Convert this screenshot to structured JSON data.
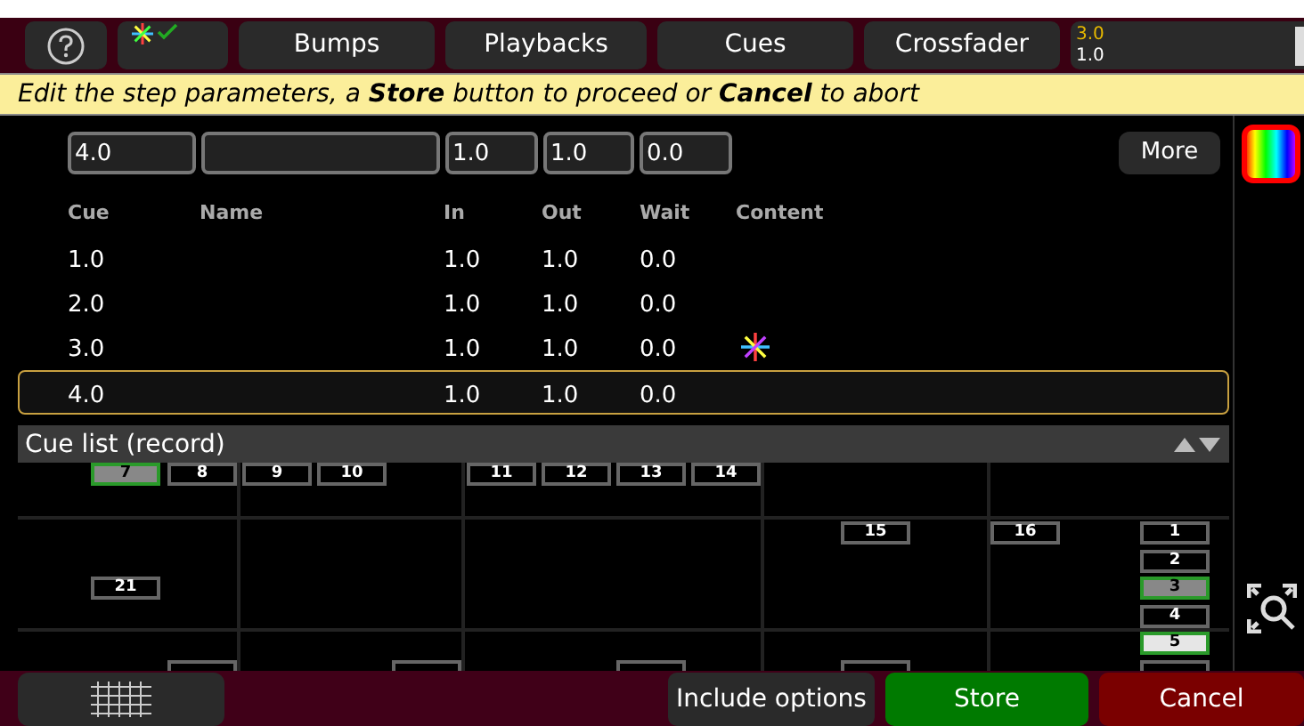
{
  "top_bar": {
    "tabs": [
      {
        "label": "Bumps",
        "selected": false
      },
      {
        "label": "Playbacks",
        "selected": false
      },
      {
        "label": "Cues",
        "selected": false
      },
      {
        "label": "Crossfader",
        "selected": false
      }
    ],
    "readout": {
      "current": "3.0",
      "next": "1.0"
    }
  },
  "banner": "Edit the step parameters, a **Store** button to proceed or **Cancel** to abort",
  "editor": {
    "cue": "4.0",
    "in": "1.0",
    "out": "1.0",
    "wait": "0.0",
    "more_button": "More"
  },
  "table": {
    "columns": [
      "Cue",
      "Name",
      "In",
      "Out",
      "Wait",
      "Content"
    ],
    "rows": [
      {
        "cue": "1.0",
        "in": "1.0",
        "out": "1.0",
        "wait": "0.0",
        "has_content": false,
        "selected": false
      },
      {
        "cue": "2.0",
        "in": "1.0",
        "out": "1.0",
        "wait": "0.0",
        "has_content": false,
        "selected": false
      },
      {
        "cue": "3.0",
        "in": "1.0",
        "out": "1.0",
        "wait": "0.0",
        "has_content": true,
        "selected": false
      },
      {
        "cue": "4.0",
        "in": "1.0",
        "out": "1.0",
        "wait": "0.0",
        "has_content": false,
        "selected": true
      }
    ]
  },
  "panel": {
    "title": "Cue list (record)"
  },
  "fixtures": [
    {
      "label": "7",
      "selected": true,
      "highlighted": false
    },
    {
      "label": "8",
      "selected": false,
      "highlighted": false
    },
    {
      "label": "9",
      "selected": false,
      "highlighted": false
    },
    {
      "label": "10",
      "selected": false,
      "highlighted": false
    },
    {
      "label": "11",
      "selected": false,
      "highlighted": false
    },
    {
      "label": "12",
      "selected": false,
      "highlighted": false
    },
    {
      "label": "13",
      "selected": false,
      "highlighted": false
    },
    {
      "label": "14",
      "selected": false,
      "highlighted": false
    },
    {
      "label": "15",
      "selected": false,
      "highlighted": false
    },
    {
      "label": "16",
      "selected": false,
      "highlighted": false
    },
    {
      "label": "1",
      "selected": false,
      "highlighted": false
    },
    {
      "label": "2",
      "selected": false,
      "highlighted": false
    },
    {
      "label": "3",
      "selected": true,
      "highlighted": false
    },
    {
      "label": "4",
      "selected": false,
      "highlighted": false
    },
    {
      "label": "5",
      "selected": true,
      "highlighted": true
    },
    {
      "label": "21",
      "selected": false,
      "highlighted": false
    }
  ],
  "bottom_bar": {
    "buttons": [
      {
        "label": "Include options",
        "kind": "plain"
      },
      {
        "label": "Store",
        "kind": "confirm"
      },
      {
        "label": "Cancel",
        "kind": "cancel"
      }
    ]
  }
}
